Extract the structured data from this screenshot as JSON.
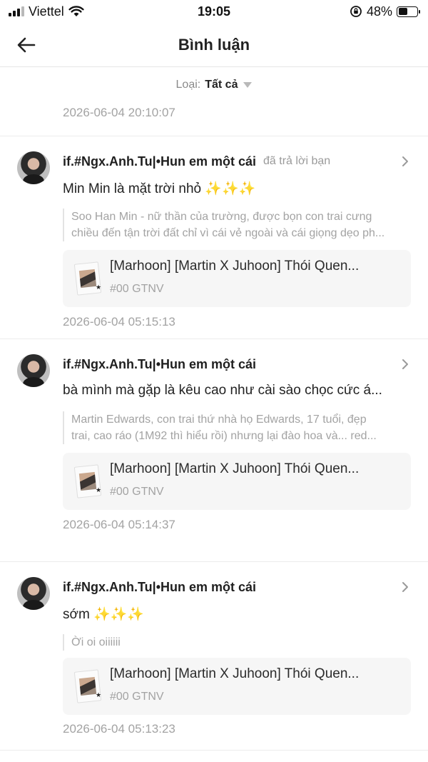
{
  "status_bar": {
    "carrier": "Viettel",
    "time": "19:05",
    "battery_percent": "48%",
    "battery_level": 0.48
  },
  "header": {
    "title": "Bình luận",
    "back_icon": "arrow-left-icon"
  },
  "filter": {
    "label": "Loại:",
    "value": "Tất cả"
  },
  "top_timestamp": "2026-06-04 20:10:07",
  "comments": [
    {
      "username": "if.#Ngx.Anh.Tu|•Hun em một cái",
      "reply_note": "đã trả lời bạn",
      "text": "Min Min là mặt trời nhỏ",
      "sparkles": "✨✨✨",
      "quote_lines": [
        "Soo Han Min - nữ thần của trường, được bọn con trai cưng",
        "chiều đến tận trời đất chỉ vì cái vẻ ngoài và cái giọng dẹo ph..."
      ],
      "story_title": "[Marhoon] [Martin X Juhoon] Thói Quen...",
      "story_tag": "#00 GTNV",
      "timestamp": "2026-06-04 05:15:13"
    },
    {
      "username": "if.#Ngx.Anh.Tu|•Hun em một cái",
      "reply_note": "",
      "text": "bà mình mà gặp là kêu cao như cài sào chọc cức á...",
      "sparkles": "",
      "quote_lines": [
        "Martin Edwards, con trai thứ nhà họ Edwards, 17 tuổi, đẹp",
        "trai, cao ráo (1M92 thì hiểu rồi) nhưng lại đào hoa và... red..."
      ],
      "story_title": "[Marhoon] [Martin X Juhoon] Thói Quen...",
      "story_tag": "#00 GTNV",
      "timestamp": "2026-06-04 05:14:37"
    },
    {
      "username": "if.#Ngx.Anh.Tu|•Hun em một cái",
      "reply_note": "",
      "text": "sớm",
      "sparkles": "✨✨✨",
      "quote_lines": [
        "Ời oi oiiiiii"
      ],
      "story_title": "[Marhoon] [Martin X Juhoon] Thói Quen...",
      "story_tag": "#00 GTNV",
      "timestamp": "2026-06-04 05:13:23"
    }
  ]
}
